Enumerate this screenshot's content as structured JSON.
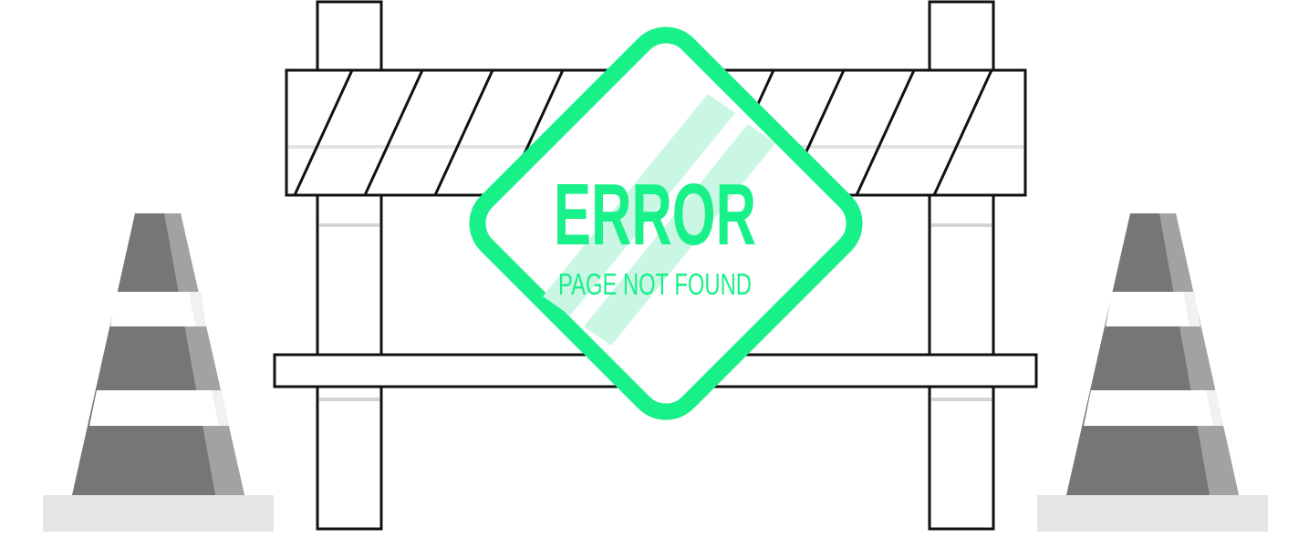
{
  "sign": {
    "title": "ERROR",
    "subtitle": "PAGE NOT FOUND"
  },
  "colors": {
    "accent": "#18f08a",
    "accent_light": "#c9f7e3",
    "cone_dark": "#767676",
    "cone_light": "#a0a0a0",
    "cone_base": "#e6e4e4",
    "outline": "#111111"
  },
  "icons": [
    "traffic-cone-icon",
    "traffic-cone-icon",
    "road-barrier-icon",
    "warning-sign-icon"
  ]
}
